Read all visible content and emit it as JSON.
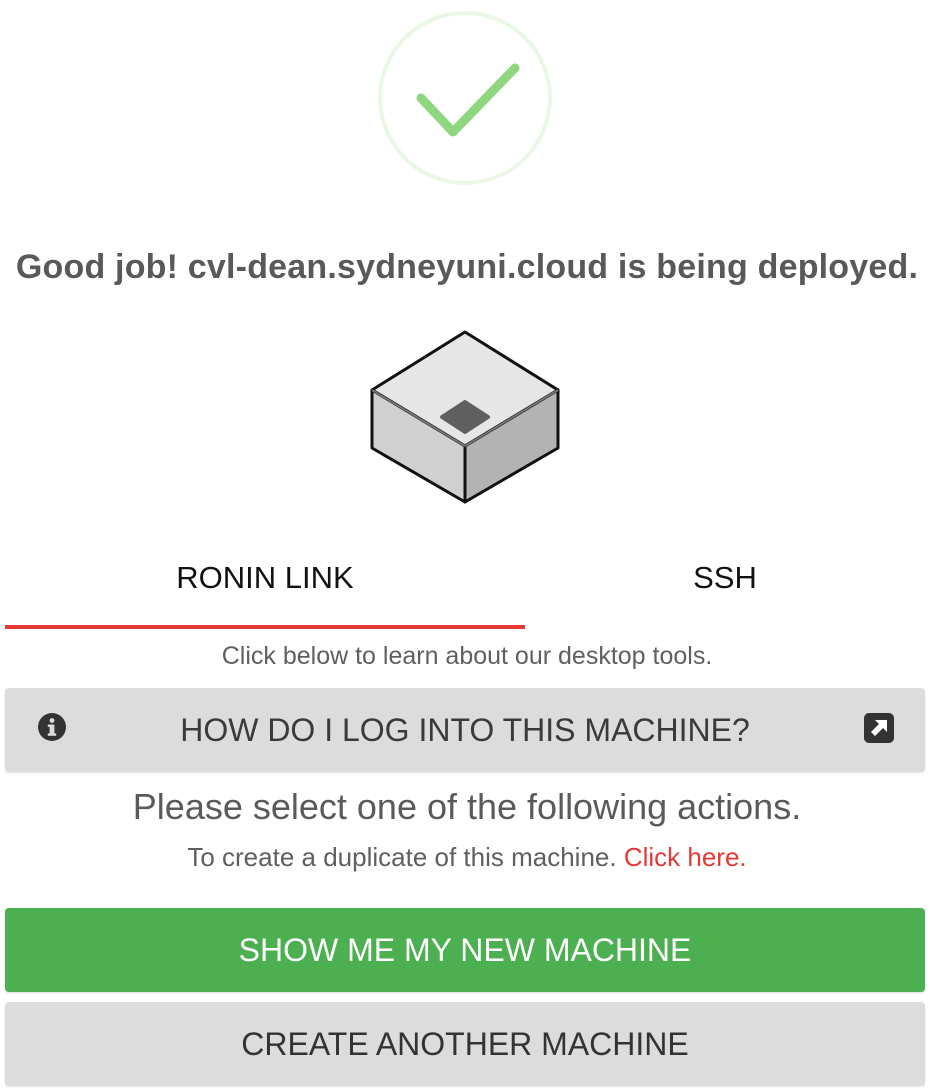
{
  "colors": {
    "success_green": "#4caf50",
    "check_green": "#8fd77f",
    "ring_green": "#eaf7e4",
    "accent_red": "#e53935",
    "button_grey": "#dcdcdc"
  },
  "status": {
    "icon": "checkmark-circle-icon",
    "headline": "Good job! cvl-dean.sydneyuni.cloud is being deployed."
  },
  "machine": {
    "icon": "machine-cube-icon"
  },
  "tabs": [
    {
      "label": "RONIN LINK",
      "active": true
    },
    {
      "label": "SSH",
      "active": false
    }
  ],
  "ronin_link": {
    "hint": "Click below to learn about our desktop tools.",
    "login_button": {
      "label": "HOW DO I LOG INTO THIS MACHINE?",
      "left_icon": "info-icon",
      "right_icon": "external-link-icon"
    }
  },
  "actions": {
    "prompt": "Please select one of the following actions.",
    "duplicate_text": "To create a duplicate of this machine.",
    "duplicate_link": "Click here.",
    "show_button": "SHOW ME MY NEW MACHINE",
    "create_button": "CREATE ANOTHER MACHINE"
  }
}
